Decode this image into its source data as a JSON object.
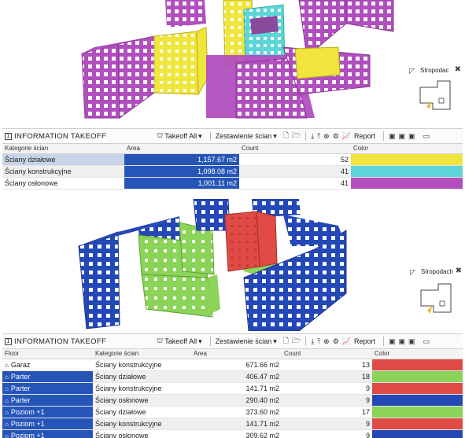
{
  "colors": {
    "yellow": "#f0e53d",
    "cyan": "#5cd6d8",
    "magenta": "#b24fbe",
    "red": "#e04b45",
    "green": "#8cd35a",
    "blue": "#2448b5",
    "selection_blue": "#2655b8"
  },
  "top_panel": {
    "navigator": {
      "title": "Stropodac"
    },
    "takeoff": {
      "title": "INFORMATION TAKEOFF",
      "takeoff_all": "Takeoff All",
      "schedule": "Zestawienie ścian",
      "report": "Report",
      "columns": [
        "Kategorie ścian",
        "Area",
        "Count",
        "Color"
      ],
      "rows": [
        {
          "category": "Ściany działowe",
          "area": "1,157.67 m2",
          "count": "52",
          "color": "#f0e53d"
        },
        {
          "category": "Ściany konstrukcyjne",
          "area": "1,098.08 m2",
          "count": "41",
          "color": "#5cd6d8"
        },
        {
          "category": "Ściany osłonowe",
          "area": "1,001.11 m2",
          "count": "41",
          "color": "#b24fbe"
        }
      ]
    }
  },
  "bottom_panel": {
    "navigator": {
      "title": "Stropodach"
    },
    "takeoff": {
      "title": "INFORMATION TAKEOFF",
      "takeoff_all": "Takeoff All",
      "schedule": "Zestawienie ścian",
      "report": "Report",
      "columns": [
        "Floor",
        "Kategorie ścian",
        "Area",
        "Count",
        "Color"
      ],
      "rows": [
        {
          "floor": "Garaż",
          "category": "Ściany konstrukcyjne",
          "area": "671.66 m2",
          "count": "13",
          "color": "#e04b45"
        },
        {
          "floor": "Parter",
          "category": "Ściany działowe",
          "area": "406.47 m2",
          "count": "18",
          "color": "#8cd35a"
        },
        {
          "floor": "Parter",
          "category": "Ściany konstrukcyjne",
          "area": "141.71 m2",
          "count": "9",
          "color": "#e04b45"
        },
        {
          "floor": "Parter",
          "category": "Ściany osłonowe",
          "area": "290.40 m2",
          "count": "9",
          "color": "#2448b5"
        },
        {
          "floor": "Poziom +1",
          "category": "Ściany działowe",
          "area": "373.60 m2",
          "count": "17",
          "color": "#8cd35a"
        },
        {
          "floor": "Poziom +1",
          "category": "Ściany konstrukcyjne",
          "area": "141.71 m2",
          "count": "9",
          "color": "#e04b45"
        },
        {
          "floor": "Poziom +1",
          "category": "Ściany osłonowe",
          "area": "309.62 m2",
          "count": "9",
          "color": "#2448b5"
        }
      ]
    }
  }
}
